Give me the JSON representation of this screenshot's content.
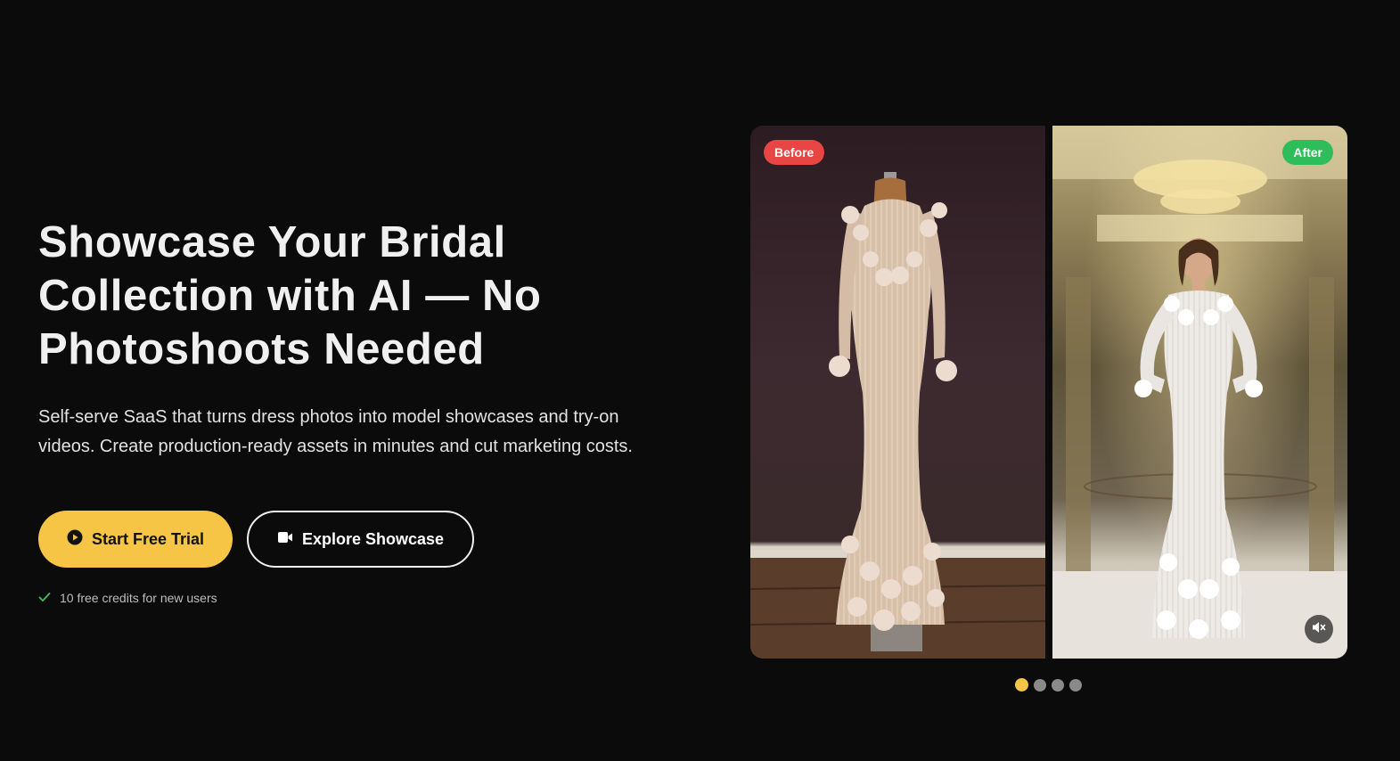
{
  "hero": {
    "title": "Showcase Your Bridal Collection with AI — No Photoshoots Needed",
    "subtitle": "Self-serve SaaS that turns dress photos into model showcases and try-on videos. Create production-ready assets in minutes and cut marketing costs.",
    "primary_cta": {
      "label": "Start Free Trial",
      "icon": "play-circle-icon"
    },
    "secondary_cta": {
      "label": "Explore Showcase",
      "icon": "video-camera-icon"
    },
    "credits_note": {
      "text": "10 free credits for new users",
      "icon": "check-icon"
    }
  },
  "comparison": {
    "before": {
      "badge": "Before",
      "image_alt": "Beaded nude-tone mermaid gown with 3D floral appliqués on a dress form in front of a dark wall"
    },
    "after": {
      "badge": "After",
      "image_alt": "AI model wearing the same white beaded mermaid gown in a luxury hotel lobby with a crystal chandelier",
      "mute_icon": "speaker-muted-icon"
    }
  },
  "carousel": {
    "count": 4,
    "active_index": 0
  },
  "colors": {
    "background": "#0b0b0c",
    "accent": "#f6c545",
    "before_badge": "#e84545",
    "after_badge": "#2ebd59",
    "check": "#3fbf5f"
  }
}
